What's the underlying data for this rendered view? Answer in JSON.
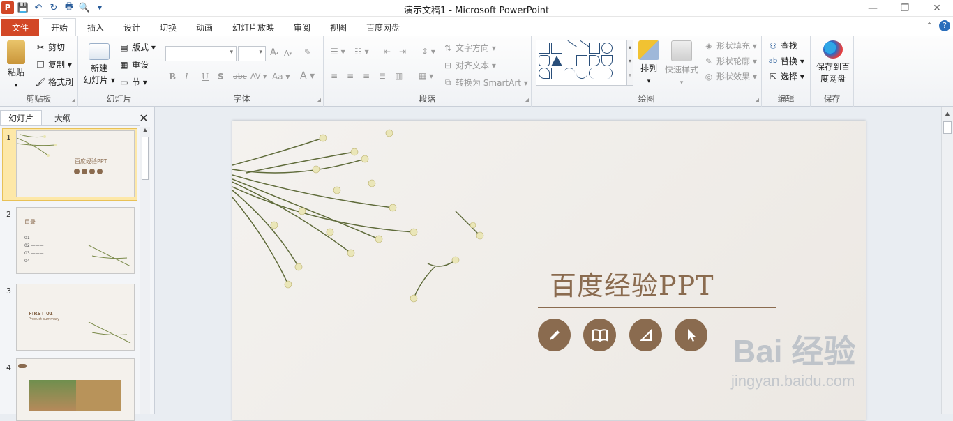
{
  "window": {
    "title": "演示文稿1  -  Microsoft PowerPoint",
    "controls": [
      "—",
      "❐",
      "✕"
    ]
  },
  "tabs": [
    {
      "label": "文件"
    },
    {
      "label": "开始"
    },
    {
      "label": "插入"
    },
    {
      "label": "设计"
    },
    {
      "label": "切换"
    },
    {
      "label": "动画"
    },
    {
      "label": "幻灯片放映"
    },
    {
      "label": "审阅"
    },
    {
      "label": "视图"
    },
    {
      "label": "百度网盘"
    }
  ],
  "ribbon": {
    "clipboard": {
      "label": "剪贴板",
      "paste": "粘贴",
      "cut": "剪切",
      "copy": "复制",
      "format_painter": "格式刷"
    },
    "slides": {
      "label": "幻灯片",
      "new_slide_1": "新建",
      "new_slide_2": "幻灯片",
      "layout": "版式",
      "reset": "重设",
      "section": "节"
    },
    "font": {
      "label": "字体"
    },
    "paragraph": {
      "label": "段落",
      "text_direction": "文字方向",
      "align_text": "对齐文本",
      "convert_smartart": "转换为 SmartArt"
    },
    "drawing": {
      "label": "绘图",
      "arrange": "排列",
      "quick_styles": "快速样式",
      "shape_fill": "形状填充",
      "shape_outline": "形状轮廓",
      "shape_effects": "形状效果"
    },
    "editing": {
      "label": "编辑",
      "find": "查找",
      "replace": "替换",
      "select": "选择"
    },
    "save": {
      "label": "保存",
      "save_to_cloud_1": "保存到百",
      "save_to_cloud_2": "度网盘"
    }
  },
  "panel": {
    "tab_slides": "幻灯片",
    "tab_outline": "大纲",
    "thumbs": [
      {
        "num": "1",
        "text": "百度经验PPT"
      },
      {
        "num": "2",
        "text": "目录",
        "items": [
          "01",
          "02",
          "03",
          "04"
        ]
      },
      {
        "num": "3",
        "text": "FIRST 01",
        "sub": "Product summary"
      },
      {
        "num": "4",
        "text": ""
      }
    ]
  },
  "slide": {
    "title": "百度经验PPT",
    "icons": [
      "pen-icon",
      "book-icon",
      "ruler-icon",
      "cursor-icon"
    ],
    "accent": "#8a6b4f"
  },
  "watermark": {
    "brand": "Bai  经验",
    "url": "jingyan.baidu.com"
  }
}
